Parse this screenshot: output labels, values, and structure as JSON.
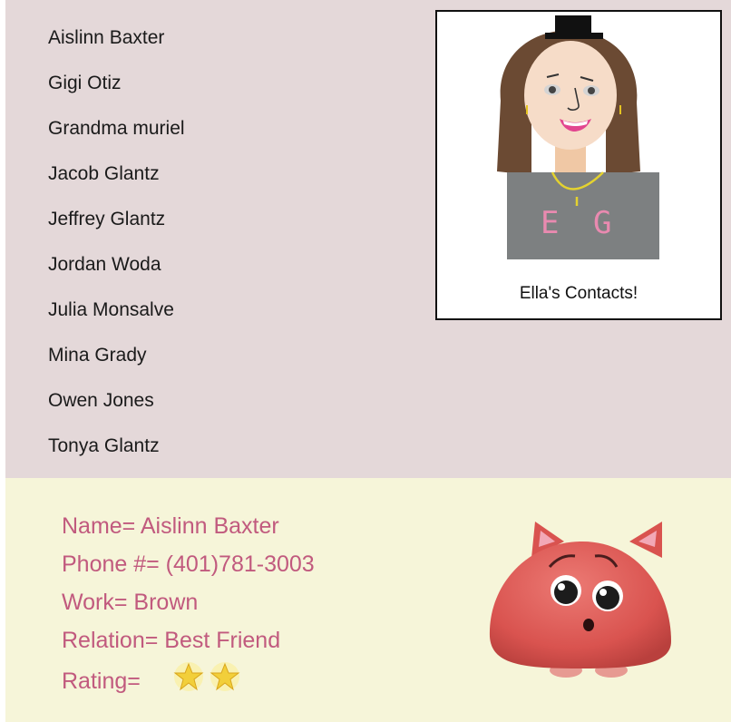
{
  "contacts": [
    "Aislinn Baxter",
    "Gigi Otiz",
    "Grandma muriel",
    "Jacob Glantz",
    "Jeffrey Glantz",
    "Jordan Woda",
    "Julia Monsalve",
    "Mina Grady",
    "Owen Jones",
    "Tonya Glantz"
  ],
  "profile_card": {
    "caption": "Ella's Contacts!",
    "shirt_letters": [
      "E",
      "G"
    ]
  },
  "details": {
    "name": "Name= Aislinn Baxter",
    "phone": "Phone #= (401)781-3003",
    "work": "Work= Brown",
    "relation": "Relation= Best Friend",
    "rating_label": "Rating=",
    "rating_value": 2
  },
  "colors": {
    "list_background": "#e4d8d9",
    "detail_background": "#f6f5d9",
    "detail_text": "#c15a7e",
    "star": "#f2cf3a",
    "mascot": "#d9534f"
  },
  "icons": {
    "rating": "star-icon",
    "mascot": "red-blob-mascot-icon",
    "avatar": "girl-avatar-icon"
  }
}
